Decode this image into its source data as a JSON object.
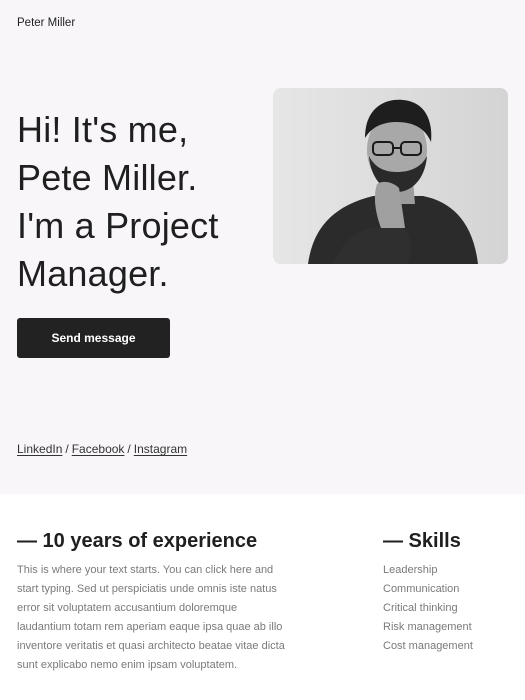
{
  "site": {
    "name": "Peter Miller"
  },
  "hero": {
    "headline_lines": [
      "Hi! It's me,",
      "Pete Miller.",
      "I'm a Project",
      "Manager."
    ],
    "cta_label": "Send message",
    "photo_alt": "Portrait of Peter Miller"
  },
  "social": {
    "links": [
      "LinkedIn",
      "Facebook",
      "Instagram"
    ],
    "separator": "/"
  },
  "experience": {
    "title": "— 10 years of experience",
    "body": "This is where your text starts. You can click here and start typing. Sed ut perspiciatis unde omnis iste natus error sit voluptatem accusantium doloremque laudantium totam rem aperiam eaque ipsa quae ab illo inventore veritatis et quasi architecto beatae vitae dicta sunt explicabo nemo enim ipsam voluptatem."
  },
  "skills": {
    "title": "— Skills",
    "items": [
      "Leadership",
      "Communication",
      "Critical thinking",
      "Risk management",
      "Cost management"
    ]
  },
  "colors": {
    "hero_bg": "#f8f6f9",
    "button_bg": "#222222",
    "text_dark": "#1f1f1f",
    "text_muted": "#7a7a7a"
  }
}
